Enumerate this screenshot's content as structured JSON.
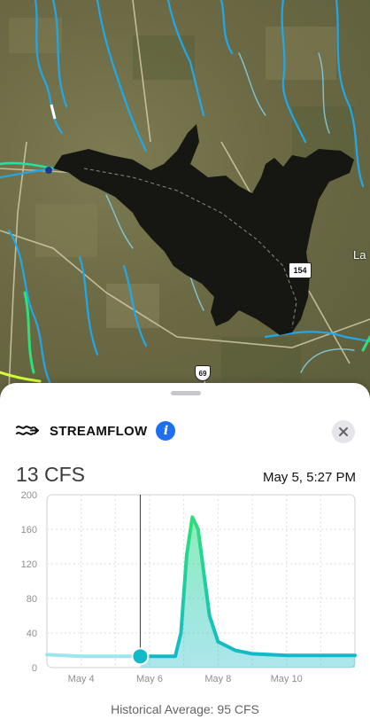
{
  "map": {
    "shields": {
      "route_154": "154",
      "route_69": "69"
    },
    "edge_label": "La"
  },
  "panel": {
    "title": "STREAMFLOW",
    "current_value": "13 CFS",
    "timestamp": "May 5, 5:27 PM",
    "footer": "Historical Average: 95 CFS"
  },
  "colors": {
    "accent": "#1e6ff0",
    "series_low": "#12b9c9",
    "series_high": "#2ee07a",
    "past_line": "#9ee6ee"
  },
  "chart_data": {
    "type": "area",
    "title": "",
    "xlabel": "",
    "ylabel": "",
    "ylim": [
      0,
      200
    ],
    "yticks": [
      0,
      40,
      80,
      120,
      160,
      200
    ],
    "xlim": [
      "2024-05-03",
      "2024-05-12"
    ],
    "xticks": [
      {
        "value": "2024-05-04",
        "label": "May 4"
      },
      {
        "value": "2024-05-06",
        "label": "May 6"
      },
      {
        "value": "2024-05-08",
        "label": "May 8"
      },
      {
        "value": "2024-05-10",
        "label": "May 10"
      }
    ],
    "grid": true,
    "current_marker": {
      "x": "2024-05-05T17:27",
      "y": 13
    },
    "series": [
      {
        "points": [
          {
            "x": "2024-05-03T00:00",
            "y": 15
          },
          {
            "x": "2024-05-04T00:00",
            "y": 13
          },
          {
            "x": "2024-05-05T17:27",
            "y": 13
          },
          {
            "x": "2024-05-06T18:00",
            "y": 13
          },
          {
            "x": "2024-05-06T22:00",
            "y": 40
          },
          {
            "x": "2024-05-07T02:00",
            "y": 130
          },
          {
            "x": "2024-05-07T06:00",
            "y": 174
          },
          {
            "x": "2024-05-07T10:00",
            "y": 160
          },
          {
            "x": "2024-05-07T14:00",
            "y": 110
          },
          {
            "x": "2024-05-07T18:00",
            "y": 60
          },
          {
            "x": "2024-05-08T00:00",
            "y": 30
          },
          {
            "x": "2024-05-08T12:00",
            "y": 20
          },
          {
            "x": "2024-05-09T00:00",
            "y": 16
          },
          {
            "x": "2024-05-10T00:00",
            "y": 14
          },
          {
            "x": "2024-05-12T00:00",
            "y": 14
          }
        ]
      }
    ]
  }
}
